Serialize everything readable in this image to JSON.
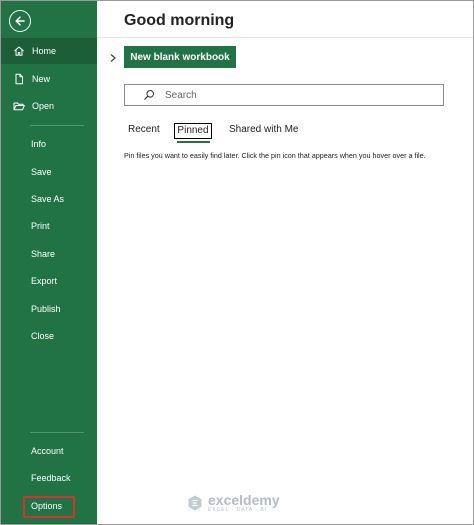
{
  "sidebar": {
    "back_icon": "back-arrow-icon",
    "items": [
      {
        "label": "Home",
        "icon": "home-icon",
        "active": true
      },
      {
        "label": "New",
        "icon": "new-file-icon"
      },
      {
        "label": "Open",
        "icon": "folder-open-icon"
      },
      {
        "label": "Info"
      },
      {
        "label": "Save"
      },
      {
        "label": "Save As"
      },
      {
        "label": "Print"
      },
      {
        "label": "Share"
      },
      {
        "label": "Export"
      },
      {
        "label": "Publish"
      },
      {
        "label": "Close"
      }
    ],
    "bottom_items": [
      {
        "label": "Account"
      },
      {
        "label": "Feedback"
      },
      {
        "label": "Options",
        "highlighted": true
      }
    ]
  },
  "main": {
    "greeting": "Good morning",
    "new_workbook_label": "New blank workbook",
    "search": {
      "placeholder": "Search"
    },
    "tabs": [
      {
        "label": "Recent"
      },
      {
        "label": "Pinned",
        "selected": true
      },
      {
        "label": "Shared with Me"
      }
    ],
    "pinned_message": "Pin files you want to easily find later. Click the pin icon that appears when you hover over a file."
  },
  "watermark": {
    "name": "exceldemy",
    "tagline": "EXCEL · DATA · BI"
  },
  "colors": {
    "sidebar_bg": "#217346",
    "active_item_bg": "#1b5e38",
    "accent": "#217346",
    "highlight_border": "#d9302b"
  }
}
